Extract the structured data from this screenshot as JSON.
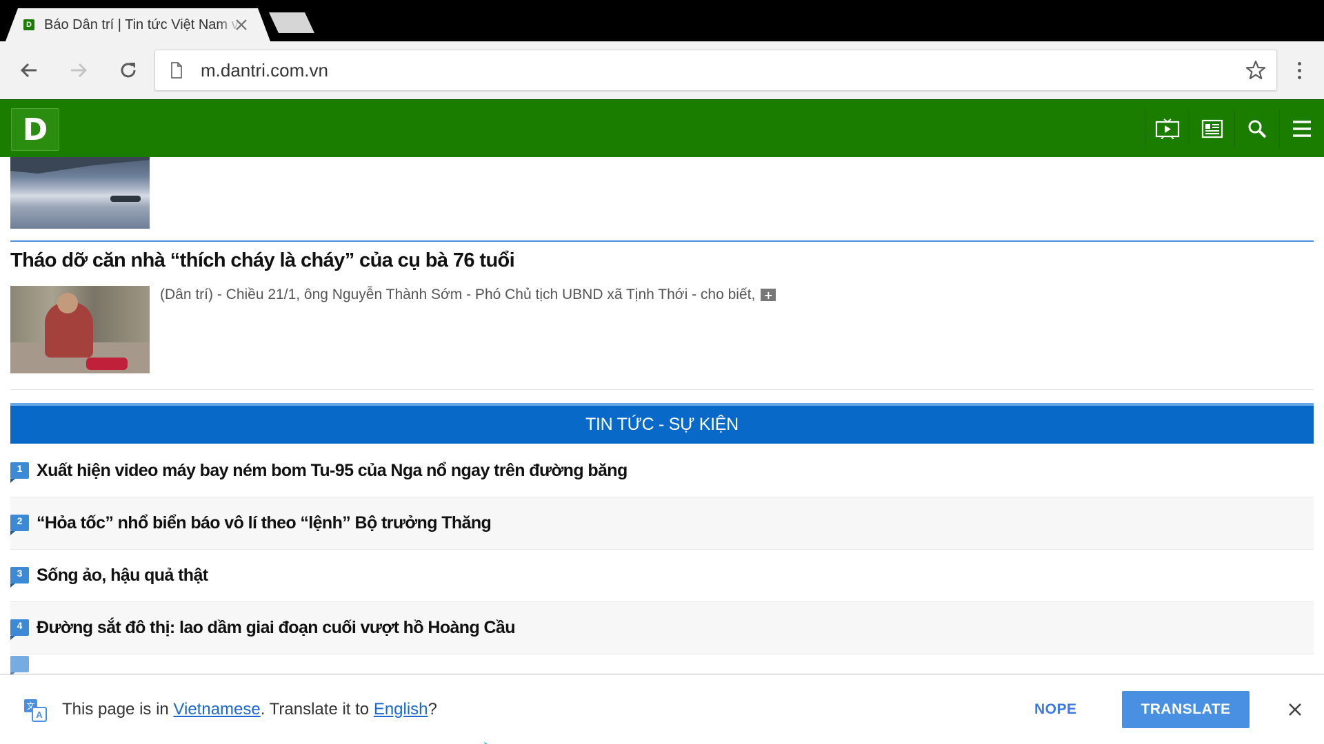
{
  "browser": {
    "tab_title": "Báo Dân trí | Tin tức Việt Nam và quốc tế",
    "favicon_letter": "D",
    "url": "m.dantri.com.vn"
  },
  "site": {
    "logo_letter": "D",
    "brand_color": "#1b7d00",
    "header_icons": [
      "video-icon",
      "newspaper-icon",
      "search-icon",
      "hamburger-menu-icon"
    ]
  },
  "featured": {
    "title": "Tháo dỡ căn nhà “thích cháy là cháy” của cụ bà 76 tuổi",
    "summary": "(Dân trí) - Chiều 21/1, ông Nguyễn Thành Sớm - Phó Chủ tịch UBND xã Tịnh Thới - cho biết,",
    "expand_label": "+"
  },
  "section": {
    "title": "TIN TỨC - SỰ KIỆN",
    "accent_color": "#0869c9"
  },
  "news": [
    {
      "num": "1",
      "title": "Xuất hiện video máy bay ném bom Tu-95 của Nga nổ ngay trên đường băng"
    },
    {
      "num": "2",
      "title": "“Hỏa tốc” nhổ biển báo vô lí theo “lệnh” Bộ trưởng Thăng"
    },
    {
      "num": "3",
      "title": "Sống ảo, hậu quả thật"
    },
    {
      "num": "4",
      "title": "Đường sắt đô thị: lao dầm giai đoạn cuối vượt hồ Hoàng Cầu"
    }
  ],
  "translate": {
    "prefix": "This page is in ",
    "source_lang": "Vietnamese",
    "middle": ". Translate it to ",
    "target_lang": "English",
    "suffix": "?",
    "nope_label": "NOPE",
    "translate_label": "TRANSLATE"
  }
}
